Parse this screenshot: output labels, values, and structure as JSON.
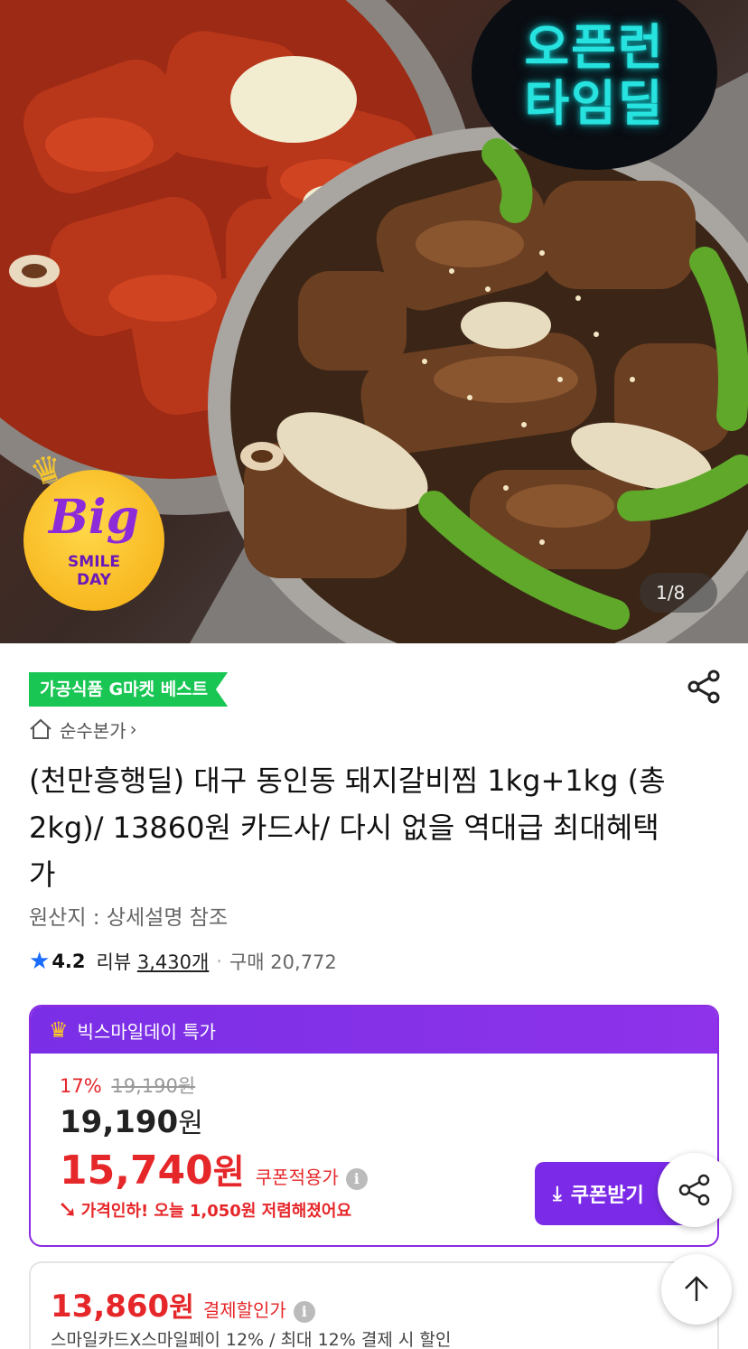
{
  "hero": {
    "badge_line1": "오픈런",
    "badge_line2": "타임딜",
    "event_big": "Big",
    "event_line1": "SMILE",
    "event_line2": "DAY",
    "counter": "1/8"
  },
  "product": {
    "best_tag": "가공식품 G마켓 베스트",
    "seller": "순수본가",
    "title": "(천만흥행딜) 대구 동인동 돼지갈비찜 1kg+1kg (총2kg)/ 13860원 카드사/ 다시 없을 역대급 최대혜택가",
    "origin": "원산지 : 상세설명 참조",
    "rating": "4.2",
    "review_label": "리뷰",
    "review_count": "3,430개",
    "purchase": "구매 20,772"
  },
  "deal": {
    "header": "빅스마일데이 특가",
    "discount_pct": "17%",
    "original_price": "19,190원",
    "base_price_num": "19,190",
    "base_price_won": "원",
    "coupon_price_num": "15,740",
    "coupon_price_won": "원",
    "coupon_label": "쿠폰적용가",
    "drop_text": "가격인하! 오늘 1,050원 저렴해졌어요",
    "coupon_button": "쿠폰받기"
  },
  "card": {
    "price_num": "13,860",
    "price_won": "원",
    "label": "결제할인가",
    "desc": "스마일카드X스마일페이 12% / 최대 12% 결제 시 할인"
  },
  "colors": {
    "accent_purple": "#7b2be8",
    "sale_red": "#e6272a",
    "best_green": "#19c654",
    "rating_blue": "#1a6cff"
  }
}
